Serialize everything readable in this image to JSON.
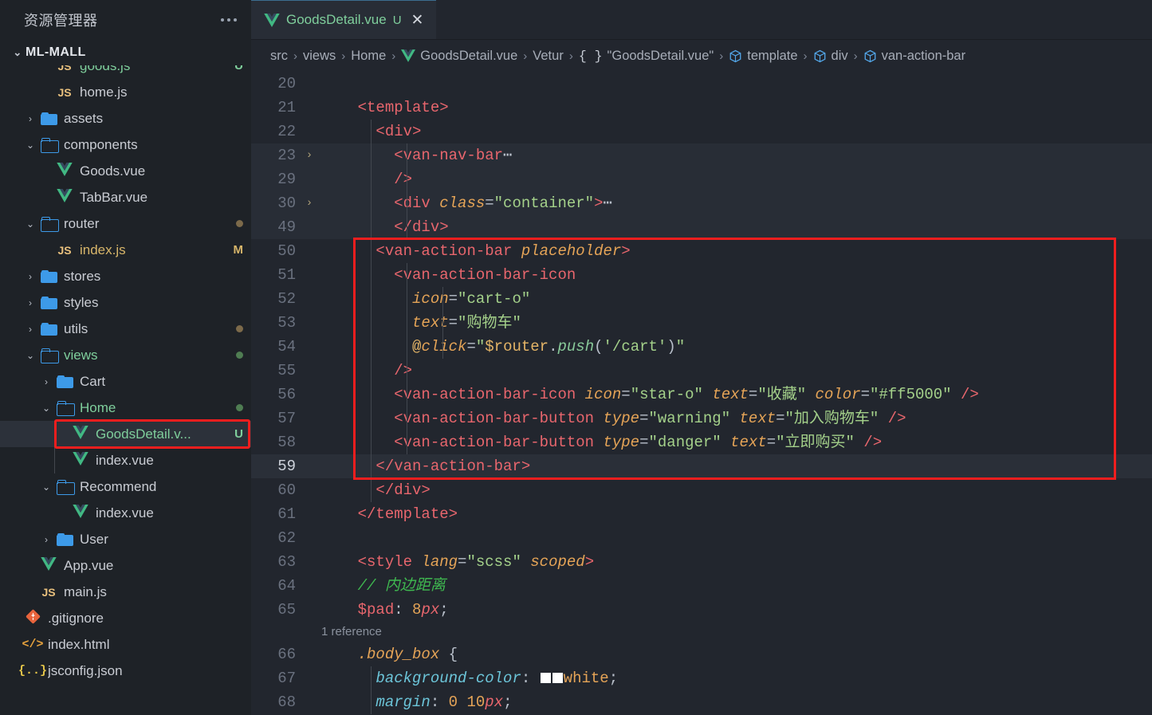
{
  "sidebar": {
    "header_title": "资源管理器",
    "more_actions": "...",
    "project_name": "ML-MALL",
    "items": [
      {
        "label": "goods.js",
        "icon": "js-icon",
        "indent": 3,
        "twisty": "",
        "badge": "U",
        "badge_color": "#7fcf9c",
        "name_color": "#7fcf9c",
        "type": "file"
      },
      {
        "label": "home.js",
        "icon": "js-icon",
        "indent": 3,
        "twisty": "",
        "badge": "",
        "badge_color": "",
        "name_color": "#c9ccd3",
        "type": "file"
      },
      {
        "label": "assets",
        "icon": "folder-closed-icon",
        "indent": 2,
        "twisty": "›",
        "badge": "",
        "badge_color": "",
        "name_color": "#c9ccd3",
        "type": "folder"
      },
      {
        "label": "components",
        "icon": "folder-open-icon",
        "indent": 2,
        "twisty": "⌄",
        "badge": "",
        "badge_color": "",
        "name_color": "#c9ccd3",
        "type": "folder"
      },
      {
        "label": "Goods.vue",
        "icon": "vue-icon",
        "indent": 3,
        "twisty": "",
        "badge": "",
        "badge_color": "",
        "name_color": "#c9ccd3",
        "type": "file"
      },
      {
        "label": "TabBar.vue",
        "icon": "vue-icon",
        "indent": 3,
        "twisty": "",
        "badge": "",
        "badge_color": "",
        "name_color": "#c9ccd3",
        "type": "file"
      },
      {
        "label": "router",
        "icon": "folder-open-icon",
        "indent": 2,
        "twisty": "⌄",
        "badge": "•",
        "badge_color": "#7c6a4a",
        "name_color": "#c9ccd3",
        "type": "folder"
      },
      {
        "label": "index.js",
        "icon": "js-icon",
        "indent": 3,
        "twisty": "",
        "badge": "M",
        "badge_color": "#d8b66a",
        "name_color": "#d8b66a",
        "type": "file"
      },
      {
        "label": "stores",
        "icon": "folder-closed-icon",
        "indent": 2,
        "twisty": "›",
        "badge": "",
        "badge_color": "",
        "name_color": "#c9ccd3",
        "type": "folder"
      },
      {
        "label": "styles",
        "icon": "folder-closed-icon",
        "indent": 2,
        "twisty": "›",
        "badge": "",
        "badge_color": "",
        "name_color": "#c9ccd3",
        "type": "folder"
      },
      {
        "label": "utils",
        "icon": "folder-closed-icon",
        "indent": 2,
        "twisty": "›",
        "badge": "•",
        "badge_color": "#7c6a4a",
        "name_color": "#c9ccd3",
        "type": "folder"
      },
      {
        "label": "views",
        "icon": "folder-open-icon",
        "indent": 2,
        "twisty": "⌄",
        "badge": "•",
        "badge_color": "#4f7d52",
        "name_color": "#7fcf9c",
        "type": "folder"
      },
      {
        "label": "Cart",
        "icon": "folder-closed-icon",
        "indent": 3,
        "twisty": "›",
        "badge": "",
        "badge_color": "",
        "name_color": "#c9ccd3",
        "type": "folder"
      },
      {
        "label": "Home",
        "icon": "folder-open-icon",
        "indent": 3,
        "twisty": "⌄",
        "badge": "•",
        "badge_color": "#4f7d52",
        "name_color": "#7fcf9c",
        "type": "folder"
      },
      {
        "label": "GoodsDetail.v...",
        "icon": "vue-icon",
        "indent": 4,
        "twisty": "",
        "badge": "U",
        "badge_color": "#7fcf9c",
        "name_color": "#7fcf9c",
        "type": "file",
        "selected": true,
        "outlined": true
      },
      {
        "label": "index.vue",
        "icon": "vue-icon",
        "indent": 4,
        "twisty": "",
        "badge": "",
        "badge_color": "",
        "name_color": "#c9ccd3",
        "type": "file"
      },
      {
        "label": "Recommend",
        "icon": "folder-open-icon",
        "indent": 3,
        "twisty": "⌄",
        "badge": "",
        "badge_color": "",
        "name_color": "#c9ccd3",
        "type": "folder"
      },
      {
        "label": "index.vue",
        "icon": "vue-icon",
        "indent": 4,
        "twisty": "",
        "badge": "",
        "badge_color": "",
        "name_color": "#c9ccd3",
        "type": "file"
      },
      {
        "label": "User",
        "icon": "folder-closed-icon",
        "indent": 3,
        "twisty": "›",
        "badge": "",
        "badge_color": "",
        "name_color": "#c9ccd3",
        "type": "folder"
      },
      {
        "label": "App.vue",
        "icon": "vue-icon",
        "indent": 2,
        "twisty": "",
        "badge": "",
        "badge_color": "",
        "name_color": "#c9ccd3",
        "type": "file"
      },
      {
        "label": "main.js",
        "icon": "js-icon",
        "indent": 2,
        "twisty": "",
        "badge": "",
        "badge_color": "",
        "name_color": "#c9ccd3",
        "type": "file"
      },
      {
        "label": ".gitignore",
        "icon": "git-icon",
        "indent": 1,
        "twisty": "",
        "badge": "",
        "badge_color": "",
        "name_color": "#c9ccd3",
        "type": "file"
      },
      {
        "label": "index.html",
        "icon": "html-icon",
        "indent": 1,
        "twisty": "",
        "badge": "",
        "badge_color": "",
        "name_color": "#c9ccd3",
        "type": "file"
      },
      {
        "label": "jsconfig.json",
        "icon": "json-icon",
        "indent": 1,
        "twisty": "",
        "badge": "",
        "badge_color": "",
        "name_color": "#c9ccd3",
        "type": "file"
      }
    ]
  },
  "tabs": [
    {
      "label": "GoodsDetail.vue",
      "icon": "vue-icon",
      "modified_badge": "U",
      "close": "✕",
      "active": true
    }
  ],
  "breadcrumb": [
    {
      "label": "src",
      "icon": "",
      "color": "#a7adb8"
    },
    {
      "label": "views",
      "icon": "",
      "color": "#a7adb8"
    },
    {
      "label": "Home",
      "icon": "",
      "color": "#a7adb8"
    },
    {
      "label": "GoodsDetail.vue",
      "icon": "vue-icon",
      "color": "#a7adb8"
    },
    {
      "label": "Vetur",
      "icon": "",
      "color": "#a7adb8"
    },
    {
      "label": "\"GoodsDetail.vue\"",
      "icon": "brace-icon",
      "color": "#a7adb8"
    },
    {
      "label": "template",
      "icon": "cube-icon",
      "color": "#a7adb8"
    },
    {
      "label": "div",
      "icon": "cube-icon",
      "color": "#a7adb8"
    },
    {
      "label": "van-action-bar",
      "icon": "cube-icon",
      "color": "#a7adb8"
    }
  ],
  "breadcrumb_separator": "›",
  "editor": {
    "current_line": 59,
    "highlight_color": "#f01e1e",
    "lines": [
      {
        "num": "20",
        "fold": "",
        "fold_bg": false,
        "tokens": []
      },
      {
        "num": "21",
        "fold": "",
        "fold_bg": false,
        "tokens": [
          {
            "t": "    ",
            "c": "t-punct"
          },
          {
            "t": "<template>",
            "c": "t-tag"
          }
        ]
      },
      {
        "num": "22",
        "fold": "",
        "fold_bg": false,
        "tokens": [
          {
            "t": "      ",
            "c": "t-punct"
          },
          {
            "t": "<div>",
            "c": "t-tag"
          }
        ]
      },
      {
        "num": "23",
        "fold": "›",
        "fold_bg": true,
        "tokens": [
          {
            "t": "        ",
            "c": "t-punct"
          },
          {
            "t": "<van-nav-bar",
            "c": "t-tag"
          },
          {
            "t": "⋯",
            "c": "t-punct"
          }
        ]
      },
      {
        "num": "29",
        "fold": "",
        "fold_bg": true,
        "tokens": [
          {
            "t": "        ",
            "c": "t-punct"
          },
          {
            "t": "/>",
            "c": "t-tag"
          }
        ]
      },
      {
        "num": "30",
        "fold": "›",
        "fold_bg": true,
        "tokens": [
          {
            "t": "        ",
            "c": "t-punct"
          },
          {
            "t": "<div ",
            "c": "t-tag"
          },
          {
            "t": "class",
            "c": "t-attr"
          },
          {
            "t": "=",
            "c": "t-eq"
          },
          {
            "t": "\"container\"",
            "c": "t-str"
          },
          {
            "t": ">",
            "c": "t-tag"
          },
          {
            "t": "⋯",
            "c": "t-punct"
          }
        ]
      },
      {
        "num": "49",
        "fold": "",
        "fold_bg": true,
        "tokens": [
          {
            "t": "        ",
            "c": "t-punct"
          },
          {
            "t": "</div>",
            "c": "t-tag"
          }
        ]
      },
      {
        "num": "50",
        "fold": "",
        "fold_bg": false,
        "tokens": [
          {
            "t": "      ",
            "c": "t-punct"
          },
          {
            "t": "<van-action-bar ",
            "c": "t-tag"
          },
          {
            "t": "placeholder",
            "c": "t-attr"
          },
          {
            "t": ">",
            "c": "t-tag"
          }
        ]
      },
      {
        "num": "51",
        "fold": "",
        "fold_bg": false,
        "tokens": [
          {
            "t": "        ",
            "c": "t-punct"
          },
          {
            "t": "<van-action-bar-icon",
            "c": "t-tag"
          }
        ]
      },
      {
        "num": "52",
        "fold": "",
        "fold_bg": false,
        "tokens": [
          {
            "t": "          ",
            "c": "t-punct"
          },
          {
            "t": "icon",
            "c": "t-attr"
          },
          {
            "t": "=",
            "c": "t-eq"
          },
          {
            "t": "\"cart-o\"",
            "c": "t-str"
          }
        ]
      },
      {
        "num": "53",
        "fold": "",
        "fold_bg": false,
        "tokens": [
          {
            "t": "          ",
            "c": "t-punct"
          },
          {
            "t": "text",
            "c": "t-attr"
          },
          {
            "t": "=",
            "c": "t-eq"
          },
          {
            "t": "\"购物车\"",
            "c": "t-str"
          }
        ]
      },
      {
        "num": "54",
        "fold": "",
        "fold_bg": false,
        "tokens": [
          {
            "t": "          ",
            "c": "t-punct"
          },
          {
            "t": "@",
            "c": "t-var"
          },
          {
            "t": "click",
            "c": "t-attr"
          },
          {
            "t": "=",
            "c": "t-eq"
          },
          {
            "t": "\"",
            "c": "t-str"
          },
          {
            "t": "$router",
            "c": "t-var"
          },
          {
            "t": ".",
            "c": "t-punct"
          },
          {
            "t": "push",
            "c": "t-fn"
          },
          {
            "t": "(",
            "c": "t-punct"
          },
          {
            "t": "'/cart'",
            "c": "t-str"
          },
          {
            "t": ")",
            "c": "t-punct"
          },
          {
            "t": "\"",
            "c": "t-str"
          }
        ]
      },
      {
        "num": "55",
        "fold": "",
        "fold_bg": false,
        "tokens": [
          {
            "t": "        ",
            "c": "t-punct"
          },
          {
            "t": "/>",
            "c": "t-tag"
          }
        ]
      },
      {
        "num": "56",
        "fold": "",
        "fold_bg": false,
        "tokens": [
          {
            "t": "        ",
            "c": "t-punct"
          },
          {
            "t": "<van-action-bar-icon ",
            "c": "t-tag"
          },
          {
            "t": "icon",
            "c": "t-attr"
          },
          {
            "t": "=",
            "c": "t-eq"
          },
          {
            "t": "\"star-o\" ",
            "c": "t-str"
          },
          {
            "t": "text",
            "c": "t-attr"
          },
          {
            "t": "=",
            "c": "t-eq"
          },
          {
            "t": "\"收藏\" ",
            "c": "t-str"
          },
          {
            "t": "color",
            "c": "t-attr"
          },
          {
            "t": "=",
            "c": "t-eq"
          },
          {
            "t": "\"#ff5000\" ",
            "c": "t-str"
          },
          {
            "t": "/>",
            "c": "t-tag"
          }
        ]
      },
      {
        "num": "57",
        "fold": "",
        "fold_bg": false,
        "tokens": [
          {
            "t": "        ",
            "c": "t-punct"
          },
          {
            "t": "<van-action-bar-button ",
            "c": "t-tag"
          },
          {
            "t": "type",
            "c": "t-attr"
          },
          {
            "t": "=",
            "c": "t-eq"
          },
          {
            "t": "\"warning\" ",
            "c": "t-str"
          },
          {
            "t": "text",
            "c": "t-attr"
          },
          {
            "t": "=",
            "c": "t-eq"
          },
          {
            "t": "\"加入购物车\" ",
            "c": "t-str"
          },
          {
            "t": "/>",
            "c": "t-tag"
          }
        ]
      },
      {
        "num": "58",
        "fold": "",
        "fold_bg": false,
        "tokens": [
          {
            "t": "        ",
            "c": "t-punct"
          },
          {
            "t": "<van-action-bar-button ",
            "c": "t-tag"
          },
          {
            "t": "type",
            "c": "t-attr"
          },
          {
            "t": "=",
            "c": "t-eq"
          },
          {
            "t": "\"danger\" ",
            "c": "t-str"
          },
          {
            "t": "text",
            "c": "t-attr"
          },
          {
            "t": "=",
            "c": "t-eq"
          },
          {
            "t": "\"立即购买\" ",
            "c": "t-str"
          },
          {
            "t": "/>",
            "c": "t-tag"
          }
        ]
      },
      {
        "num": "59",
        "fold": "",
        "fold_bg": false,
        "current": true,
        "tokens": [
          {
            "t": "      ",
            "c": "t-punct"
          },
          {
            "t": "</van-action-bar>",
            "c": "t-tag"
          }
        ]
      },
      {
        "num": "60",
        "fold": "",
        "fold_bg": false,
        "tokens": [
          {
            "t": "      ",
            "c": "t-punct"
          },
          {
            "t": "</div>",
            "c": "t-tag"
          }
        ]
      },
      {
        "num": "61",
        "fold": "",
        "fold_bg": false,
        "tokens": [
          {
            "t": "    ",
            "c": "t-punct"
          },
          {
            "t": "</template>",
            "c": "t-tag"
          }
        ]
      },
      {
        "num": "62",
        "fold": "",
        "fold_bg": false,
        "tokens": []
      },
      {
        "num": "63",
        "fold": "",
        "fold_bg": false,
        "tokens": [
          {
            "t": "    ",
            "c": "t-punct"
          },
          {
            "t": "<style ",
            "c": "t-tag"
          },
          {
            "t": "lang",
            "c": "t-attr"
          },
          {
            "t": "=",
            "c": "t-eq"
          },
          {
            "t": "\"scss\" ",
            "c": "t-str"
          },
          {
            "t": "scoped",
            "c": "t-attr"
          },
          {
            "t": ">",
            "c": "t-tag"
          }
        ]
      },
      {
        "num": "64",
        "fold": "",
        "fold_bg": false,
        "tokens": [
          {
            "t": "    ",
            "c": "t-punct"
          },
          {
            "t": "// 内边距离",
            "c": "t-comment"
          }
        ]
      },
      {
        "num": "65",
        "fold": "",
        "fold_bg": false,
        "tokens": [
          {
            "t": "    ",
            "c": "t-punct"
          },
          {
            "t": "$pad",
            "c": "t-sass"
          },
          {
            "t": ": ",
            "c": "t-punct"
          },
          {
            "t": "8",
            "c": "t-num"
          },
          {
            "t": "px",
            "c": "t-unit"
          },
          {
            "t": ";",
            "c": "t-punct"
          }
        ]
      },
      {
        "num": "66",
        "fold": "",
        "fold_bg": false,
        "codelens": "1 reference",
        "tokens": [
          {
            "t": "    ",
            "c": "t-punct"
          },
          {
            "t": ".body_box",
            "c": "t-sel"
          },
          {
            "t": " {",
            "c": "t-punct"
          }
        ]
      },
      {
        "num": "67",
        "fold": "",
        "fold_bg": false,
        "tokens": [
          {
            "t": "      ",
            "c": "t-punct"
          },
          {
            "t": "background-color",
            "c": "t-prop"
          },
          {
            "t": ": ",
            "c": "t-punct"
          },
          {
            "t": "__SWATCH____SWATCH__",
            "c": "swatch-pair"
          },
          {
            "t": "white",
            "c": "t-white"
          },
          {
            "t": ";",
            "c": "t-punct"
          }
        ]
      },
      {
        "num": "68",
        "fold": "",
        "fold_bg": false,
        "tokens": [
          {
            "t": "      ",
            "c": "t-punct"
          },
          {
            "t": "margin",
            "c": "t-prop"
          },
          {
            "t": ": ",
            "c": "t-punct"
          },
          {
            "t": "0 ",
            "c": "t-num"
          },
          {
            "t": "10",
            "c": "t-num"
          },
          {
            "t": "px",
            "c": "t-unit"
          },
          {
            "t": ";",
            "c": "t-punct"
          }
        ]
      }
    ]
  }
}
